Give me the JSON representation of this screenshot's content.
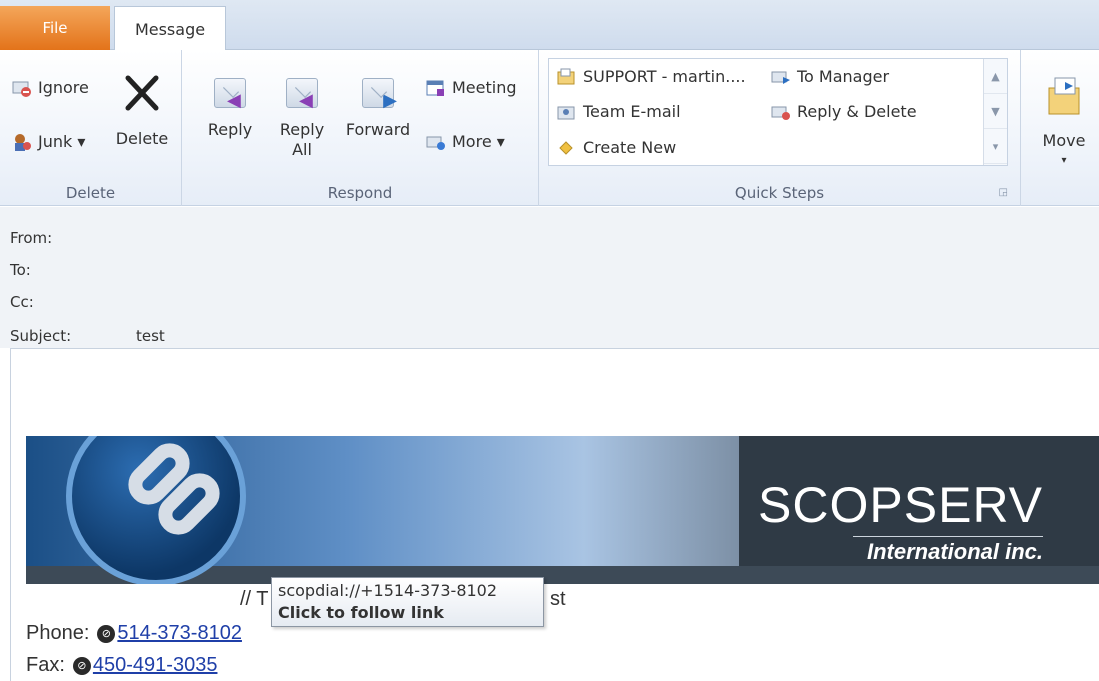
{
  "tabs": {
    "file": "File",
    "message": "Message"
  },
  "ribbon": {
    "delete_group": {
      "label": "Delete",
      "ignore": "Ignore",
      "junk": "Junk ▾",
      "delete": "Delete"
    },
    "respond_group": {
      "label": "Respond",
      "reply": "Reply",
      "reply_all_1": "Reply",
      "reply_all_2": "All",
      "forward": "Forward",
      "meeting": "Meeting",
      "more": "More ▾"
    },
    "quick_steps": {
      "label": "Quick Steps",
      "items": [
        "SUPPORT - martin....",
        "To Manager",
        "Team E-mail",
        "Reply & Delete",
        "Create New"
      ],
      "scroll": [
        "▲",
        "▼",
        "▾"
      ]
    },
    "move_group": {
      "move": "Move",
      "move_arrow": "▾"
    }
  },
  "headers": {
    "from": "From:",
    "to": "To:",
    "cc": "Cc:",
    "subject_label": "Subject:",
    "subject_value": "test"
  },
  "banner": {
    "brand": "SCOPSERV",
    "brand_sub": "International inc."
  },
  "body": {
    "slogan_start": "// T",
    "slogan_end": "st",
    "phone_label": "Phone:",
    "phone_value": "514-373-8102",
    "fax_label": "Fax:",
    "fax_value": "450-491-3035"
  },
  "tooltip": {
    "url": "scopdial://+1514-373-8102",
    "hint": "Click to follow link"
  }
}
